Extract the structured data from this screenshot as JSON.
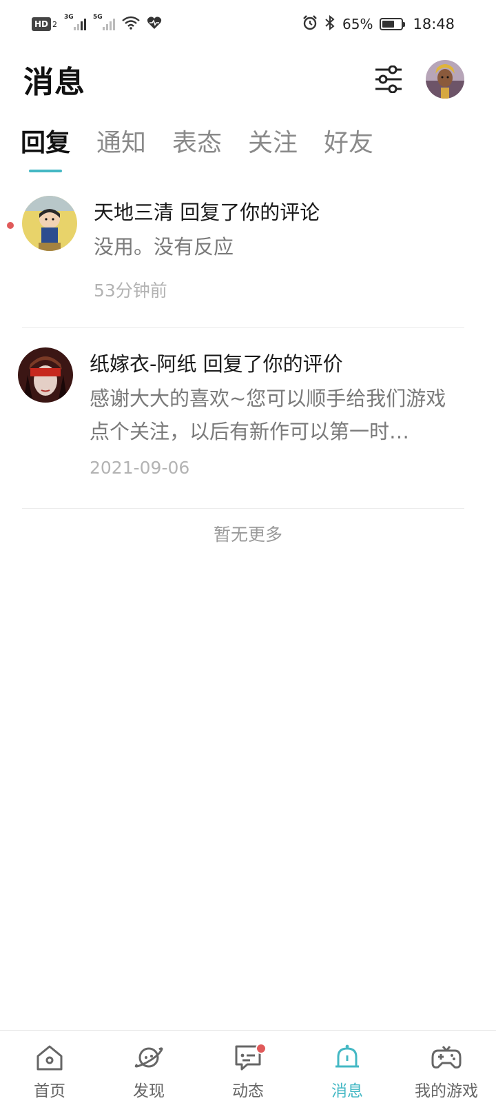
{
  "status_bar": {
    "hd": "HD",
    "hd_sub": "2",
    "sim1": "3G",
    "sim2": "5G",
    "battery_level": 0.65,
    "battery": "65%",
    "time": "18:48",
    "icons": [
      "wifi-icon",
      "health-icon",
      "alarm-icon",
      "bluetooth-icon"
    ]
  },
  "header": {
    "title": "消息",
    "filter_icon": "sliders-icon",
    "avatar": "user-avatar"
  },
  "tabs": [
    {
      "label": "回复",
      "active": true
    },
    {
      "label": "通知",
      "active": false
    },
    {
      "label": "表态",
      "active": false
    },
    {
      "label": "关注",
      "active": false
    },
    {
      "label": "好友",
      "active": false
    }
  ],
  "messages": [
    {
      "user": "天地三清",
      "title": "天地三清 回复了你的评论",
      "content": "没用。没有反应",
      "time": "53分钟前",
      "unread": true
    },
    {
      "user": "纸嫁衣-阿纸",
      "title": "纸嫁衣-阿纸 回复了你的评价",
      "content": "感谢大大的喜欢~您可以顺手给我们游戏点个关注，以后有新作可以第一时…",
      "time": "2021-09-06",
      "unread": false
    }
  ],
  "end_text": "暂无更多",
  "bottom_nav": [
    {
      "label": "首页",
      "icon": "home-icon",
      "active": false
    },
    {
      "label": "发现",
      "icon": "planet-icon",
      "active": false
    },
    {
      "label": "动态",
      "icon": "chat-icon",
      "active": false,
      "badge": true
    },
    {
      "label": "消息",
      "icon": "bell-icon",
      "active": true
    },
    {
      "label": "我的游戏",
      "icon": "gamepad-icon",
      "active": false
    }
  ],
  "colors": {
    "accent": "#44b8c4",
    "badge": "#e05a5a",
    "text_primary": "#1a1a1a",
    "text_secondary": "#7a7a7a",
    "text_muted": "#b3b3b3"
  }
}
